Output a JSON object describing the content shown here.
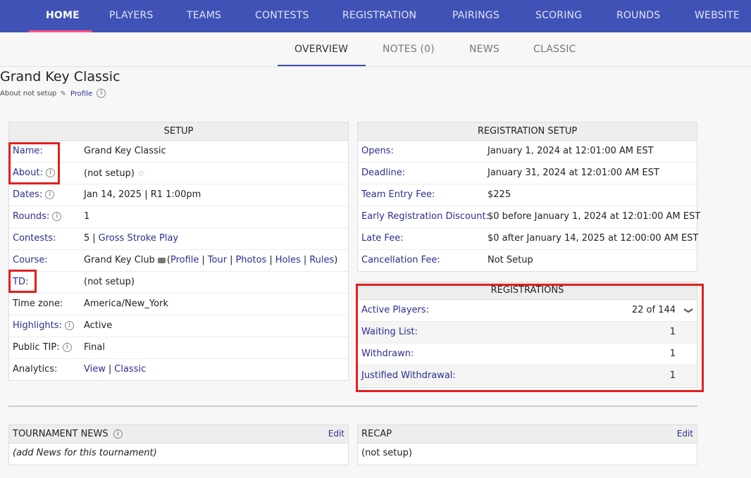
{
  "topnav": {
    "items": [
      "HOME",
      "PLAYERS",
      "TEAMS",
      "CONTESTS",
      "REGISTRATION",
      "PAIRINGS",
      "SCORING",
      "ROUNDS",
      "WEBSITE"
    ],
    "active": "HOME"
  },
  "subnav": {
    "items": [
      "OVERVIEW",
      "NOTES (0)",
      "NEWS",
      "CLASSIC"
    ],
    "active": "OVERVIEW"
  },
  "header": {
    "title": "Grand Key Classic",
    "about_text": "About not setup",
    "profile_link": "Profile"
  },
  "setup": {
    "title": "SETUP",
    "name_label": "Name",
    "name_value": "Grand Key Classic",
    "about_label": "About",
    "about_value": "(not setup)",
    "dates_label": "Dates",
    "dates_value": "Jan 14, 2025 | R1 1:00pm",
    "rounds_label": "Rounds",
    "rounds_value": "1",
    "contests_label": "Contests",
    "contests_count": "5",
    "contests_link": "Gross Stroke Play",
    "course_label": "Course",
    "course_value": "Grand Key Club",
    "course_links": [
      "Profile",
      "Tour",
      "Photos",
      "Holes",
      "Rules"
    ],
    "td_label": "TD",
    "td_value": "(not setup)",
    "timezone_label": "Time zone",
    "timezone_value": "America/New_York",
    "highlights_label": "Highlights",
    "highlights_value": "Active",
    "tip_label": "Public TIP",
    "tip_value": "Final",
    "analytics_label": "Analytics",
    "analytics_links": [
      "View",
      "Classic"
    ]
  },
  "registration_setup": {
    "title": "REGISTRATION SETUP",
    "rows": [
      {
        "label": "Opens",
        "value": "January 1, 2024 at 12:01:00 AM EST"
      },
      {
        "label": "Deadline",
        "value": "January 31, 2024 at 12:01:00 AM EST"
      },
      {
        "label": "Team Entry Fee",
        "value": "$225"
      },
      {
        "label": "Early Registration Discount",
        "value": "$0 before January 1, 2024 at 12:01:00 AM EST"
      },
      {
        "label": "Late Fee",
        "value": "$0 after January 14, 2025 at 12:00:00 AM EST"
      },
      {
        "label": "Cancellation Fee",
        "value": "Not Setup"
      }
    ]
  },
  "registrations": {
    "title": "REGISTRATIONS",
    "rows": [
      {
        "label": "Active Players",
        "value": "22 of 144"
      },
      {
        "label": "Waiting List",
        "value": "1"
      },
      {
        "label": "Withdrawn",
        "value": "1"
      },
      {
        "label": "Justified Withdrawal",
        "value": "1"
      }
    ]
  },
  "news": {
    "title": "TOURNAMENT NEWS",
    "edit": "Edit",
    "body": "(add News for this tournament)"
  },
  "recap": {
    "title": "RECAP",
    "edit": "Edit",
    "body": "(not setup)"
  }
}
